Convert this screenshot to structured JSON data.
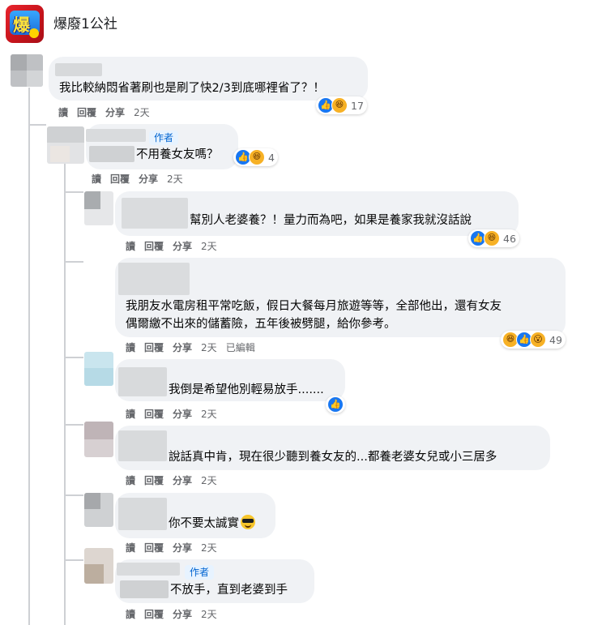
{
  "group": {
    "name": "爆廢1公社",
    "logo_glyph": "爆",
    "logo_icon": "group-logo-icon"
  },
  "colors": {
    "bubble": "#f0f2f5",
    "like": "#1877f2",
    "haha": "#f7b125",
    "meta_text": "#65676b",
    "author_badge": "#0064d1"
  },
  "actions": {
    "read": "讀",
    "reply": "回覆",
    "share": "分享",
    "edited": "已編輯"
  },
  "author_badge_text": "作者",
  "comments": [
    {
      "text": "我比較納悶省著刷也是刷了快2/3到底哪裡省了？！",
      "time": "2天",
      "reactions": [
        "like",
        "haha"
      ],
      "reaction_count": "17"
    },
    {
      "text": "不用養女友嗎？",
      "time": "2天",
      "reactions": [
        "like",
        "haha"
      ],
      "reaction_count": "4",
      "is_author": true
    },
    {
      "text": "幫別人老婆養？！量力而為吧，如果是養家我就沒話說",
      "time": "2天",
      "reactions": [
        "like",
        "haha"
      ],
      "reaction_count": "46"
    },
    {
      "text_lines": [
        "我朋友水電房租平常吃飯，假日大餐每月旅遊等等，全部他出，還有女友",
        "偶爾繳不出來的儲蓄險，五年後被劈腿，給你參考。"
      ],
      "time": "2天",
      "edited": true,
      "reactions": [
        "haha",
        "like",
        "wow"
      ],
      "reaction_count": "49"
    },
    {
      "text": "我倒是希望他別輕易放手.......",
      "time": "2天",
      "reactions": [
        "like"
      ],
      "reaction_count": ""
    },
    {
      "text": "說話真中肯，現在很少聽到養女友的...都養老婆女兒或小三居多",
      "time": "2天",
      "reactions": [],
      "reaction_count": ""
    },
    {
      "text": "你不要太誠實",
      "time": "2天",
      "trailing_emoji": "sunglasses-emoji-icon",
      "reactions": [],
      "reaction_count": ""
    },
    {
      "text": "不放手，直到老婆到手",
      "time": "2天",
      "reactions": [],
      "reaction_count": "",
      "is_author": true
    }
  ]
}
